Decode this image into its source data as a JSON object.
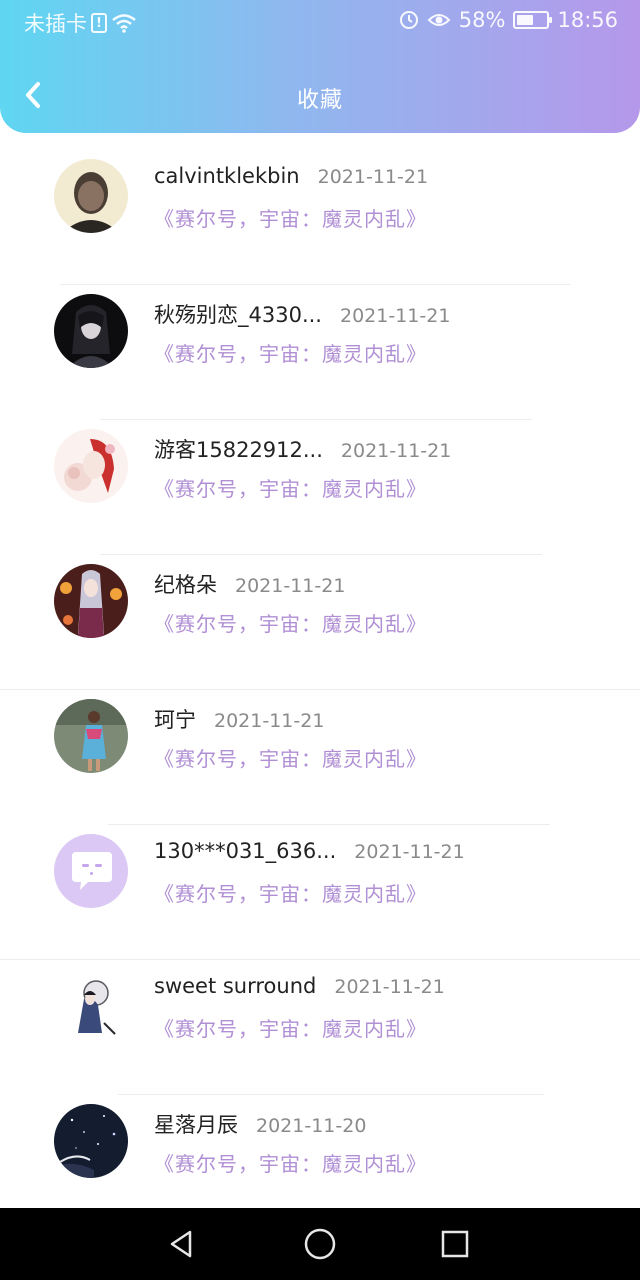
{
  "status_bar": {
    "carrier": "未插卡",
    "battery_percent": "58%",
    "battery_level": 0.58,
    "time": "18:56"
  },
  "header": {
    "title": "收藏",
    "back_icon": "chevron-left-icon",
    "gradient_start": "#5fd6f2",
    "gradient_end": "#b598ea"
  },
  "favorites": [
    {
      "username": "calvintklekbin",
      "date": "2021-11-21",
      "title": "《赛尔号，宇宙：魔灵内乱》",
      "avatar": "photo-man-avatar"
    },
    {
      "username": "秋殇别恋_4330...",
      "date": "2021-11-21",
      "title": "《赛尔号，宇宙：魔灵内乱》",
      "avatar": "anime-dark-avatar"
    },
    {
      "username": "游客15822912...",
      "date": "2021-11-21",
      "title": "《赛尔号，宇宙：魔灵内乱》",
      "avatar": "anime-red-flower-avatar"
    },
    {
      "username": "纪格朵",
      "date": "2021-11-21",
      "title": "《赛尔号，宇宙：魔灵内乱》",
      "avatar": "anime-lantern-avatar"
    },
    {
      "username": "珂宁",
      "date": "2021-11-21",
      "title": "《赛尔号，宇宙：魔灵内乱》",
      "avatar": "photo-girl-avatar"
    },
    {
      "username": "130***031_636...",
      "date": "2021-11-21",
      "title": "《赛尔号，宇宙：魔灵内乱》",
      "avatar": "default-chat-avatar"
    },
    {
      "username": "sweet surround",
      "date": "2021-11-21",
      "title": "《赛尔号，宇宙：魔灵内乱》",
      "avatar": "ink-figure-avatar"
    },
    {
      "username": "星落月辰",
      "date": "2021-11-20",
      "title": "《赛尔号，宇宙：魔灵内乱》",
      "avatar": "night-sky-avatar"
    }
  ],
  "colors": {
    "title_link": "#b08fd4",
    "date": "#8a8a8a",
    "username": "#222222"
  },
  "system_nav": {
    "back": "triangle-back-icon",
    "home": "circle-home-icon",
    "recents": "square-recents-icon"
  }
}
